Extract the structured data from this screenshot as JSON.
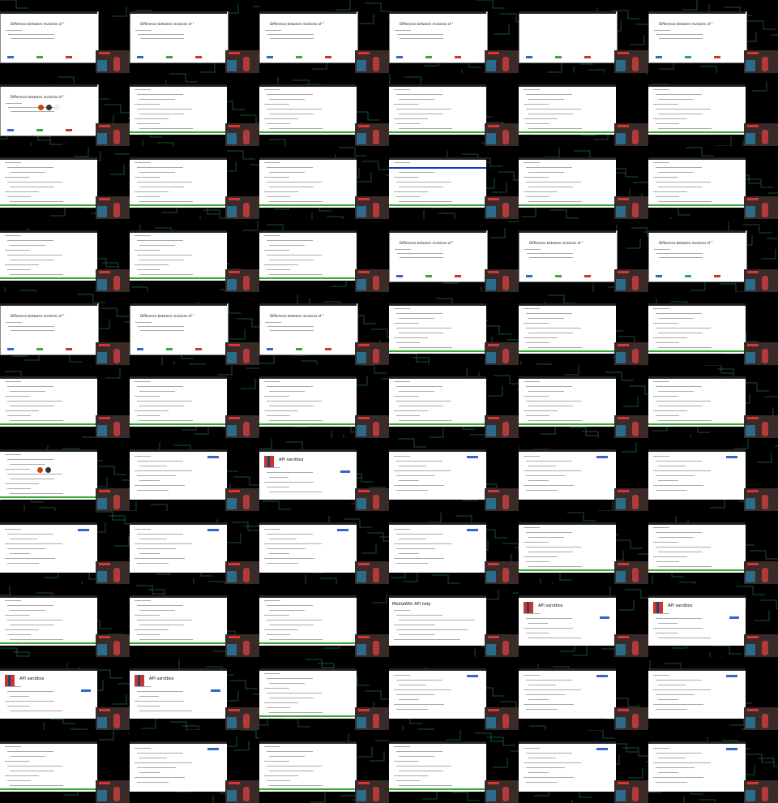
{
  "screen": {
    "columns": 6,
    "rows": 11
  },
  "tiles": [
    {
      "kind": "diff"
    },
    {
      "kind": "diff"
    },
    {
      "kind": "diff"
    },
    {
      "kind": "diff"
    },
    {
      "kind": "diff-empty"
    },
    {
      "kind": "diff"
    },
    {
      "kind": "diff-icons"
    },
    {
      "kind": "code"
    },
    {
      "kind": "code"
    },
    {
      "kind": "code"
    },
    {
      "kind": "code"
    },
    {
      "kind": "code"
    },
    {
      "kind": "code"
    },
    {
      "kind": "code"
    },
    {
      "kind": "code"
    },
    {
      "kind": "code-blue"
    },
    {
      "kind": "code"
    },
    {
      "kind": "code"
    },
    {
      "kind": "code"
    },
    {
      "kind": "code"
    },
    {
      "kind": "code"
    },
    {
      "kind": "diff"
    },
    {
      "kind": "diff"
    },
    {
      "kind": "diff"
    },
    {
      "kind": "diff"
    },
    {
      "kind": "diff"
    },
    {
      "kind": "diff"
    },
    {
      "kind": "code"
    },
    {
      "kind": "code"
    },
    {
      "kind": "code"
    },
    {
      "kind": "code"
    },
    {
      "kind": "code"
    },
    {
      "kind": "code"
    },
    {
      "kind": "code"
    },
    {
      "kind": "code"
    },
    {
      "kind": "code"
    },
    {
      "kind": "code-icons"
    },
    {
      "kind": "web-list"
    },
    {
      "kind": "wiki"
    },
    {
      "kind": "web-form"
    },
    {
      "kind": "web-form"
    },
    {
      "kind": "web-form"
    },
    {
      "kind": "web-form"
    },
    {
      "kind": "web-form"
    },
    {
      "kind": "web-form"
    },
    {
      "kind": "web-form"
    },
    {
      "kind": "code"
    },
    {
      "kind": "code"
    },
    {
      "kind": "code"
    },
    {
      "kind": "code"
    },
    {
      "kind": "code"
    },
    {
      "kind": "web-doc"
    },
    {
      "kind": "wiki"
    },
    {
      "kind": "wiki"
    },
    {
      "kind": "wiki"
    },
    {
      "kind": "wiki"
    },
    {
      "kind": "code"
    },
    {
      "kind": "web-form"
    },
    {
      "kind": "web-form"
    },
    {
      "kind": "web-form"
    },
    {
      "kind": "code"
    },
    {
      "kind": "web-form"
    },
    {
      "kind": "code"
    },
    {
      "kind": "code"
    },
    {
      "kind": "web-form"
    },
    {
      "kind": "web-form"
    }
  ],
  "labels": {
    "diff_title": "Difference between revisions of \"",
    "wiki_title": "API sandbox",
    "wiki_doc_title": "MediaWiki API help"
  },
  "colors": {
    "background": "#000000",
    "panel": "#ffffff",
    "circuit": "#1b5a3a",
    "green_bar": "#33aa33",
    "blue_bar": "#123cc7",
    "btn_blue": "#3366cc",
    "btn_green": "#33aa44",
    "btn_red": "#cc3333"
  }
}
